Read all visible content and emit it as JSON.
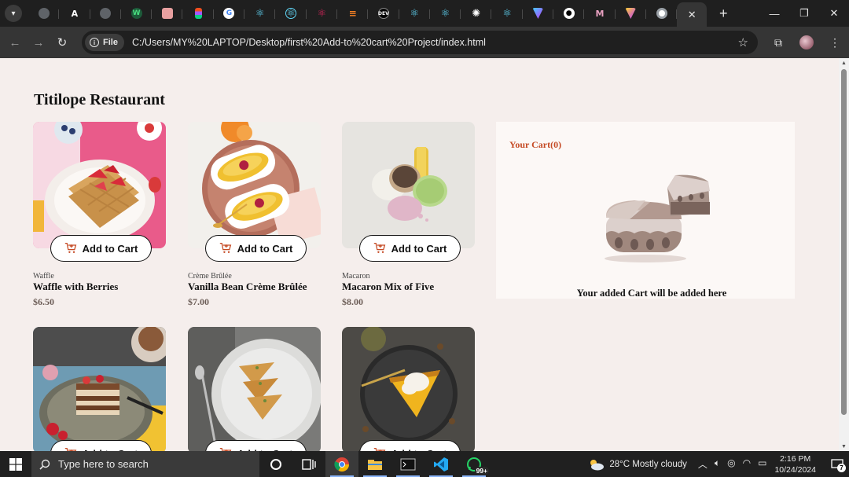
{
  "browser": {
    "tab_count": 21,
    "active_tab_close": "✕",
    "new_tab": "+",
    "file_chip": "File",
    "url": "C:/Users/MY%20LAPTOP/Desktop/first%20Add-to%20cart%20Project/index.html"
  },
  "page": {
    "title": "Titilope Restaurant",
    "add_to_cart_label": "Add to Cart",
    "products": [
      {
        "category": "Waffle",
        "name": "Waffle with Berries",
        "price": "$6.50"
      },
      {
        "category": "Crème Brûlée",
        "name": "Vanilla Bean Crème Brûlée",
        "price": "$7.00"
      },
      {
        "category": "Macaron",
        "name": "Macaron Mix of Five",
        "price": "$8.00"
      },
      {
        "category": "",
        "name": "",
        "price": ""
      },
      {
        "category": "",
        "name": "",
        "price": ""
      },
      {
        "category": "",
        "name": "",
        "price": ""
      }
    ],
    "cart": {
      "title": "Your Cart(0)",
      "empty_message": "Your added Cart will be added here"
    }
  },
  "taskbar": {
    "search_placeholder": "Type here to search",
    "whatsapp_badge": "99+",
    "weather": "28°C  Mostly cloudy",
    "time": "2:16 PM",
    "date": "10/24/2024",
    "notification_count": "7"
  },
  "colors": {
    "page_bg": "#f5eeec",
    "cart_title": "#c54a24",
    "price": "#6c5d57"
  }
}
